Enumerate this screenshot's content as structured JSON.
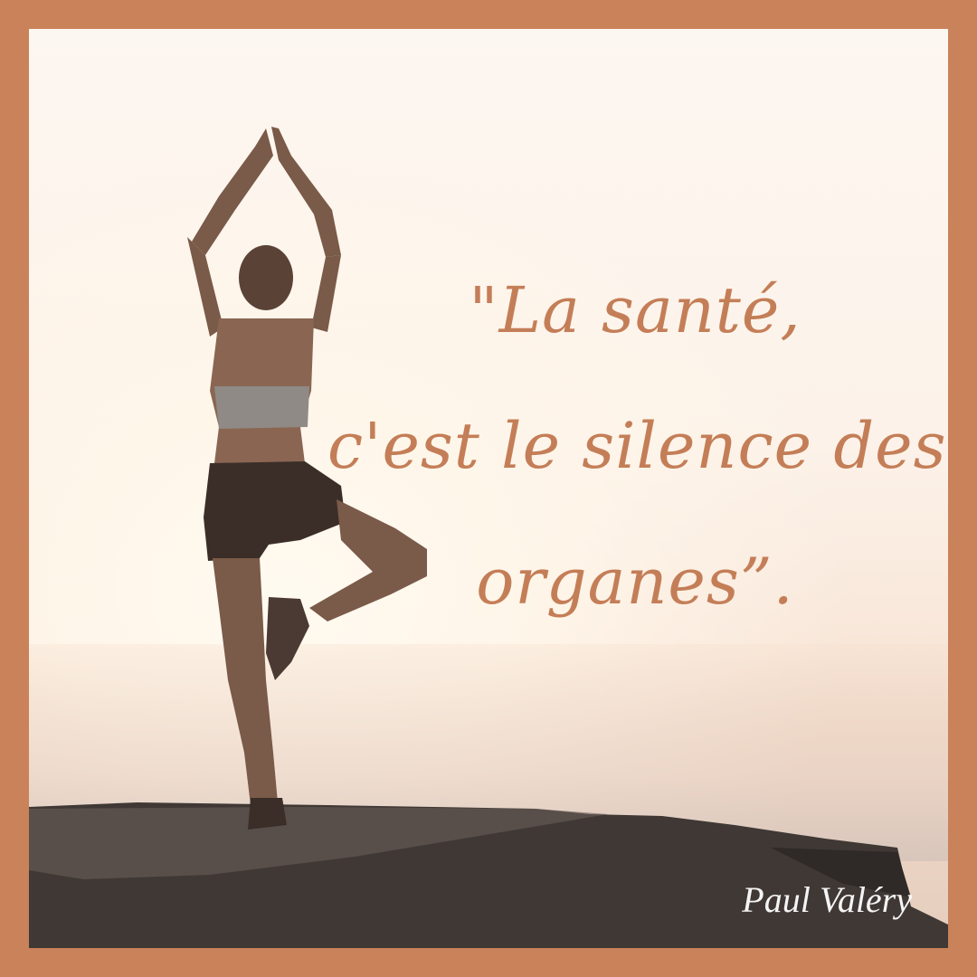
{
  "quote": {
    "lines": [
      "\"La santé,",
      "c'est le silence des",
      "organes”."
    ]
  },
  "author": "Paul Valéry",
  "colors": {
    "frame": "#c9825a",
    "quote_text": "#c47e57",
    "author_text": "#ffffff"
  }
}
